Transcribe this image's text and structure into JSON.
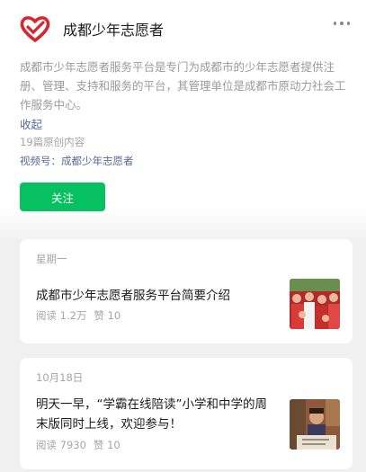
{
  "header": {
    "account_name": "成都少年志愿者"
  },
  "profile": {
    "description": "成都市少年志愿者服务平台是专门为成都市的少年志愿者提供注册、管理、支持和服务的平台，其管理单位是成都市原动力社会工作服务中心。",
    "collapse_label": "收起",
    "article_count": "19篇原创内容",
    "channel": "视频号：成都少年志愿者",
    "follow_label": "关注"
  },
  "articles": [
    {
      "date": "星期一",
      "title": "成都市少年志愿者服务平台简要介绍",
      "reads": "阅读 1.2万",
      "likes": "赞 10"
    },
    {
      "date": "10月18日",
      "title": "明天一早，“学霸在线陪读”小学和中学的周末版同时上线，欢迎参与！",
      "reads": "阅读 7930",
      "likes": "赞 10"
    }
  ],
  "colors": {
    "brand": "#d7262d",
    "accent": "#07c160",
    "link": "#576b95"
  }
}
